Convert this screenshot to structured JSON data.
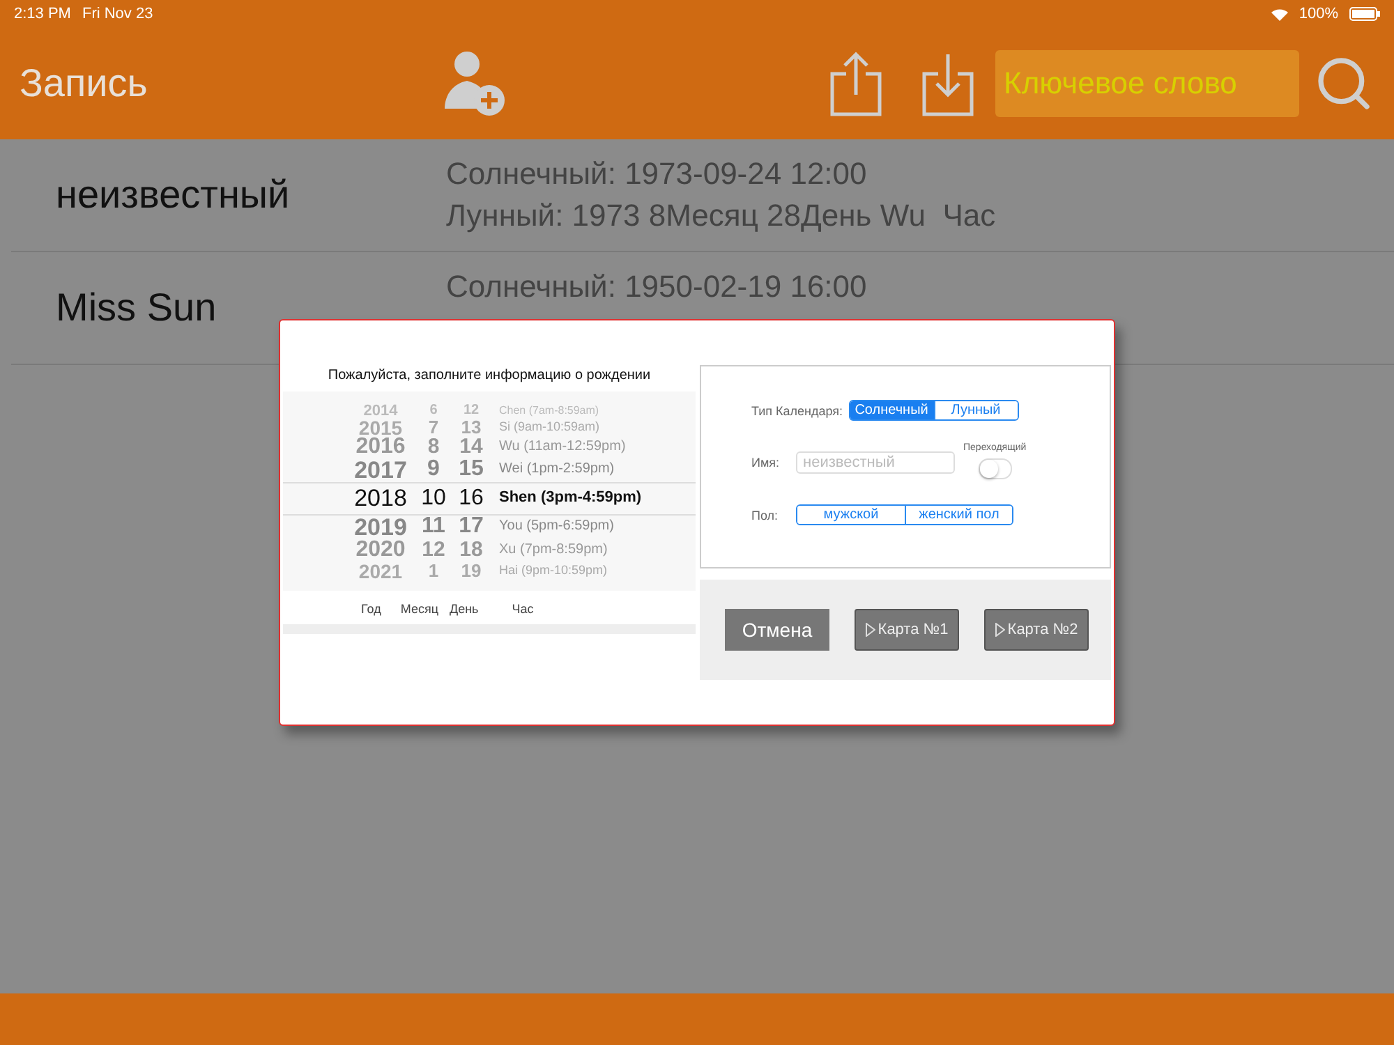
{
  "status_bar": {
    "time": "2:13 PM",
    "date": "Fri Nov 23",
    "battery": "100%"
  },
  "header": {
    "title": "Запись",
    "search": {
      "placeholder": "Ключевое слово"
    }
  },
  "records": [
    {
      "name": "неизвестный",
      "solar": "Солнечный: 1973-09-24 12:00",
      "lunar": "Лунный: 1973 8Месяц 28День Wu  Час"
    },
    {
      "name": "Miss Sun",
      "solar": "Солнечный: 1950-02-19 16:00"
    }
  ],
  "dialog": {
    "title": "Пожалуйста, заполните информацию о рождении",
    "picker": {
      "rows": [
        {
          "year": "2014",
          "month": "6",
          "day": "12",
          "hour": "Chen (7am-8:59am)",
          "selected": false
        },
        {
          "year": "2015",
          "month": "7",
          "day": "13",
          "hour": "Si (9am-10:59am)",
          "selected": false
        },
        {
          "year": "2016",
          "month": "8",
          "day": "14",
          "hour": "Wu (11am-12:59pm)",
          "selected": false
        },
        {
          "year": "2017",
          "month": "9",
          "day": "15",
          "hour": "Wei (1pm-2:59pm)",
          "selected": false
        },
        {
          "year": "2018",
          "month": "10",
          "day": "16",
          "hour": "Shen (3pm-4:59pm)",
          "selected": true
        },
        {
          "year": "2019",
          "month": "11",
          "day": "17",
          "hour": "You (5pm-6:59pm)",
          "selected": false
        },
        {
          "year": "2020",
          "month": "12",
          "day": "18",
          "hour": "Xu (7pm-8:59pm)",
          "selected": false
        },
        {
          "year": "2021",
          "month": "1",
          "day": "19",
          "hour": "Hai (9pm-10:59pm)",
          "selected": false
        }
      ],
      "columns": [
        "Год",
        "Месяц",
        "День",
        "Час"
      ]
    },
    "calendar_type": {
      "label": "Тип Календаря:",
      "options": [
        {
          "label": "Солнечный",
          "selected": true
        },
        {
          "label": "Лунный",
          "selected": false
        }
      ]
    },
    "name": {
      "label": "Имя:",
      "placeholder": "неизвестный"
    },
    "transitional": {
      "label": "Переходящий",
      "on": false
    },
    "gender": {
      "label": "Пол:",
      "options": [
        {
          "label": "мужской",
          "selected": false
        },
        {
          "label": "женский пол",
          "selected": false
        }
      ]
    },
    "buttons": [
      {
        "label": "Отмена",
        "kind": "cancel"
      },
      {
        "label": "Карта №1",
        "kind": "chart"
      },
      {
        "label": "Карта №2",
        "kind": "chart"
      }
    ]
  }
}
